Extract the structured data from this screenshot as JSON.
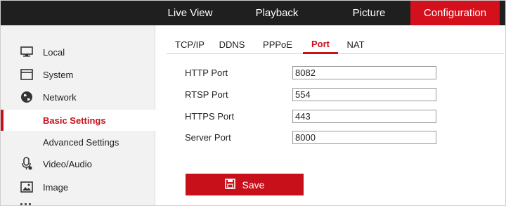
{
  "topnav": {
    "live_view": "Live View",
    "playback": "Playback",
    "picture": "Picture",
    "configuration": "Configuration",
    "active_color": "#d4101c"
  },
  "sidebar": {
    "items": [
      {
        "label": "Local",
        "icon": "monitor-icon"
      },
      {
        "label": "System",
        "icon": "system-window-icon"
      },
      {
        "label": "Network",
        "icon": "globe-icon"
      },
      {
        "label": "Basic Settings",
        "icon": null,
        "active": true
      },
      {
        "label": "Advanced Settings",
        "icon": null
      },
      {
        "label": "Video/Audio",
        "icon": "mic-icon"
      },
      {
        "label": "Image",
        "icon": "picture-icon"
      }
    ]
  },
  "tabs": [
    {
      "label": "TCP/IP"
    },
    {
      "label": "DDNS"
    },
    {
      "label": "PPPoE"
    },
    {
      "label": "Port",
      "active": true
    },
    {
      "label": "NAT"
    }
  ],
  "form": {
    "http_port": {
      "label": "HTTP Port",
      "value": "8082"
    },
    "rtsp_port": {
      "label": "RTSP Port",
      "value": "554"
    },
    "https_port": {
      "label": "HTTPS Port",
      "value": "443"
    },
    "server_port": {
      "label": "Server Port",
      "value": "8000"
    }
  },
  "save_button": {
    "label": "Save",
    "icon": "floppy-disk-icon"
  },
  "accent_color": "#c8101b"
}
